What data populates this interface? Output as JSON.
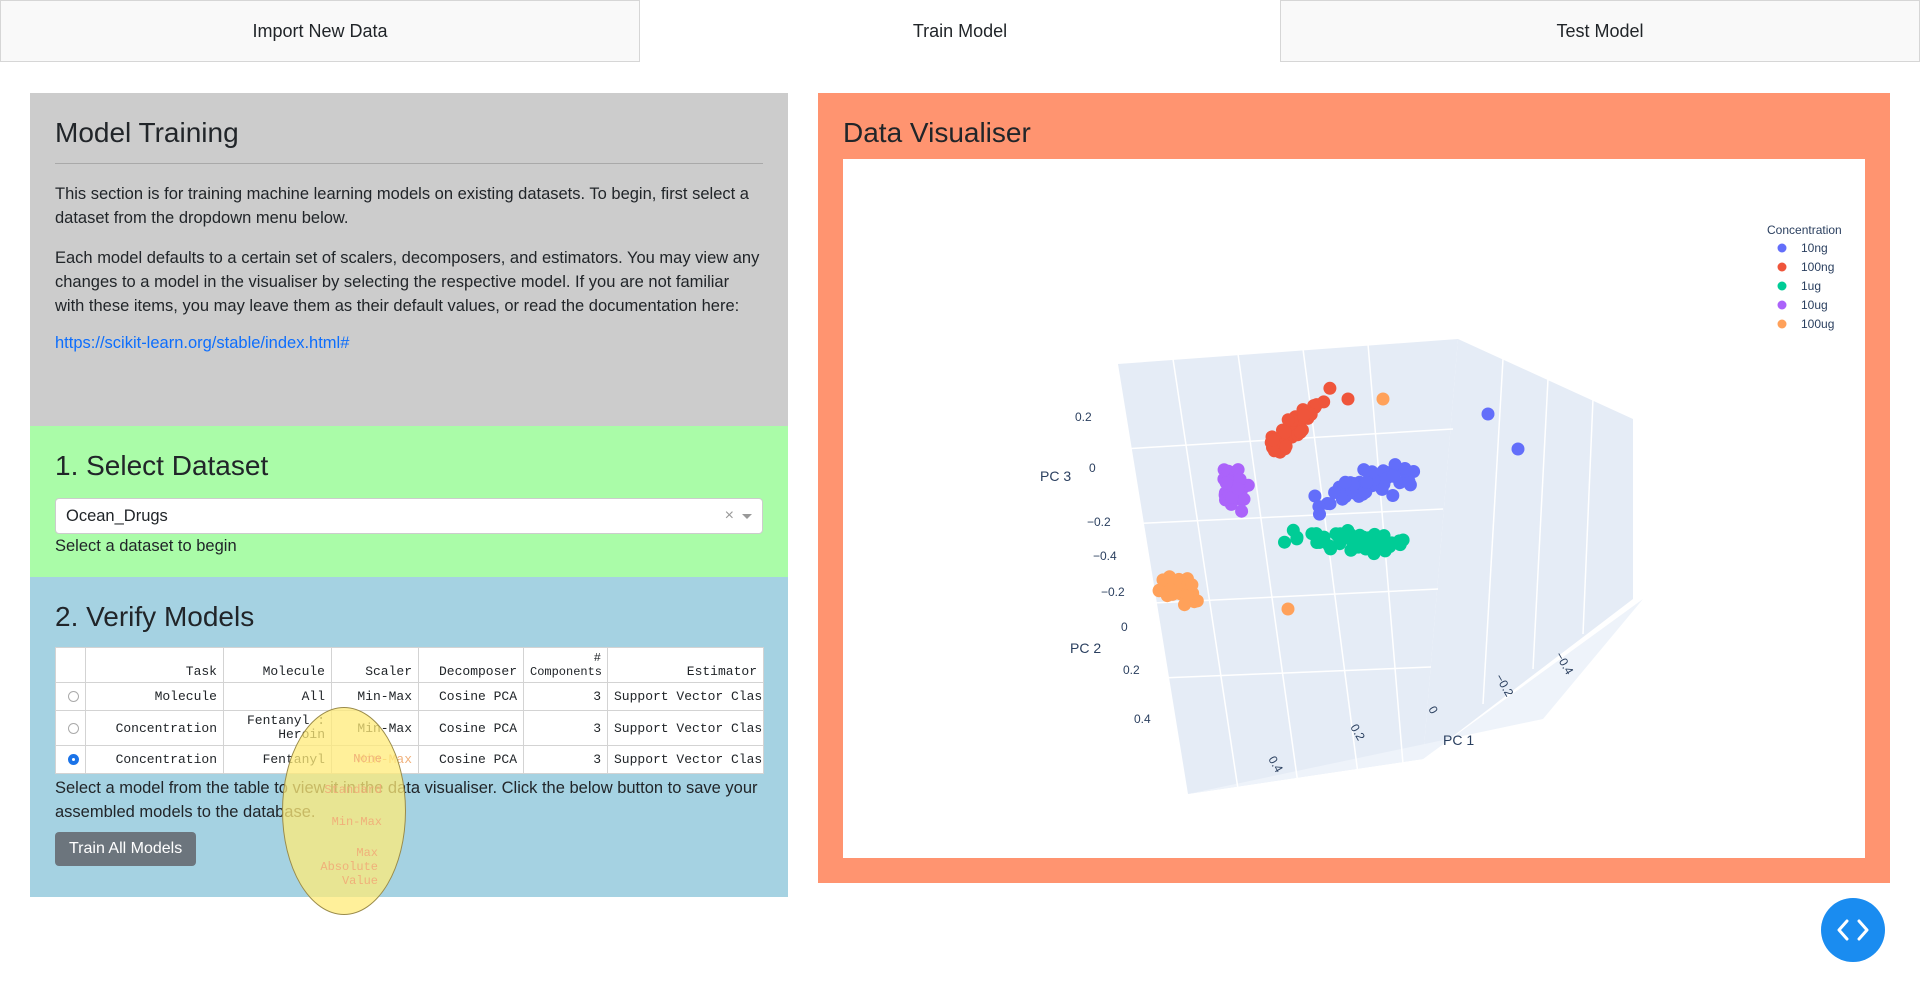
{
  "tabs": [
    "Import New Data",
    "Train Model",
    "Test Model"
  ],
  "training": {
    "title": "Model Training",
    "para1": "This section is for training machine learning models on existing datasets. To begin, first select a dataset from the dropdown menu below.",
    "para2": "Each model defaults to a certain set of scalers, decomposers, and estimators. You may view any changes to a model in the visualiser by selecting the respective model. If you are not familiar with these items, you may leave them as their default values, or read the documentation here:",
    "link": "https://scikit-learn.org/stable/index.html#"
  },
  "dataset": {
    "title": "1. Select Dataset",
    "selected": "Ocean_Drugs",
    "clear": "×",
    "hint": "Select a dataset to begin"
  },
  "verify": {
    "title": "2. Verify Models",
    "columns": [
      "Task",
      "Molecule",
      "Scaler",
      "Decomposer",
      "# Components",
      "Estimator"
    ],
    "rows": [
      {
        "task": "Molecule",
        "molecule": "All",
        "scaler": "Min-Max",
        "decomposer": "Cosine PCA",
        "components": "3",
        "estimator": "Support Vector Classif"
      },
      {
        "task": "Concentration",
        "molecule": "Fentanyl : Heroin",
        "scaler": "Min-Max",
        "decomposer": "Cosine PCA",
        "components": "3",
        "estimator": "Support Vector Classif"
      },
      {
        "task": "Concentration",
        "molecule": "Fentanyl",
        "scaler": "Min-Max",
        "decomposer": "Cosine PCA",
        "components": "3",
        "estimator": "Support Vector Classif"
      }
    ],
    "selected_row": 2,
    "instructions": "Select a model from the table to view it in the data visualiser. Click the below button to save your assembled models to the database.",
    "train_button": "Train All Models",
    "scaler_options": [
      "None",
      "Standard",
      "Min-Max",
      "Max Absolute Value"
    ]
  },
  "visualiser": {
    "title": "Data Visualiser",
    "legend_title": "Concentration",
    "axes": {
      "x": "PC 1",
      "y": "PC 2",
      "z": "PC 3"
    },
    "ticks": {
      "z": [
        "0.2",
        "0",
        "−0.2",
        "−0.4"
      ],
      "y": [
        "−0.2",
        "0",
        "0.2",
        "0.4"
      ],
      "x": [
        "0.4",
        "0.2",
        "0",
        "−0.2",
        "−0.4"
      ]
    }
  },
  "chart_data": {
    "type": "scatter",
    "title": "",
    "legend_title": "Concentration",
    "xlabel": "PC 1",
    "ylabel": "PC 2",
    "zlabel": "PC 3",
    "series": [
      {
        "name": "10ng",
        "color": "#636efa",
        "cluster": "upper-right"
      },
      {
        "name": "100ng",
        "color": "#ef553b",
        "cluster": "upper-center"
      },
      {
        "name": "1ug",
        "color": "#00cc96",
        "cluster": "center"
      },
      {
        "name": "10ug",
        "color": "#ab63fa",
        "cluster": "center-left"
      },
      {
        "name": "100ug",
        "color": "#ffa15a",
        "cluster": "lower-left"
      }
    ]
  }
}
